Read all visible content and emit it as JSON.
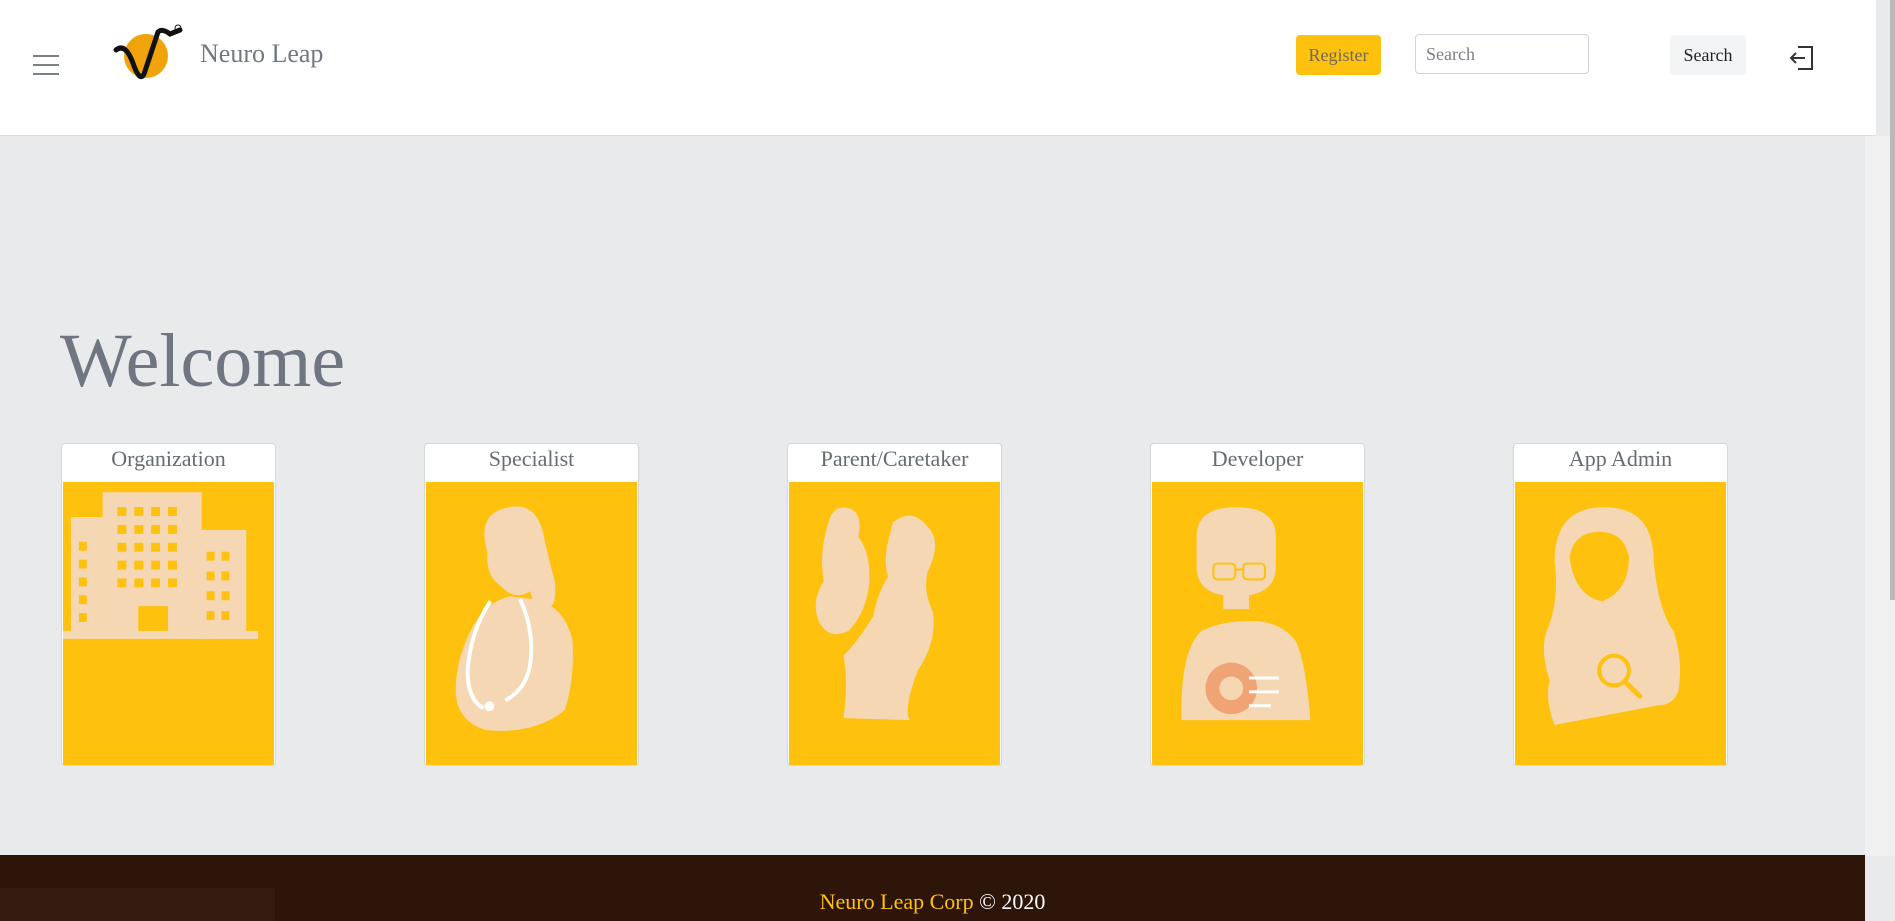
{
  "header": {
    "brand": "Neuro Leap",
    "register_label": "Register",
    "search_placeholder": "Search",
    "search_button_label": "Search"
  },
  "main": {
    "welcome": "Welcome",
    "cards": [
      {
        "label": "Organization",
        "icon": "building-icon"
      },
      {
        "label": "Specialist",
        "icon": "doctor-icon"
      },
      {
        "label": "Parent/Caretaker",
        "icon": "parent-child-icon"
      },
      {
        "label": "Developer",
        "icon": "developer-icon"
      },
      {
        "label": "App Admin",
        "icon": "admin-icon"
      }
    ]
  },
  "footer": {
    "brand": "Neuro Leap Corp",
    "copyright": " © 2020"
  },
  "colors": {
    "accent": "#fdc10e",
    "footer_bg": "#2e1509",
    "page_bg": "#e9eaec",
    "icon_fill": "#f5d7b3"
  }
}
